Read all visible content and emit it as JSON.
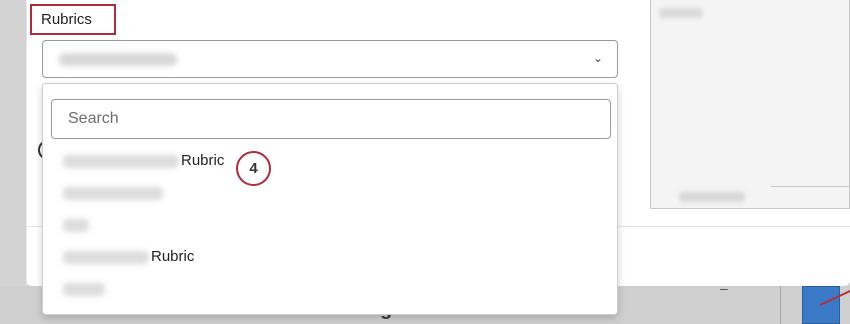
{
  "modal": {
    "section_label": "Rubrics",
    "select_chevron": "⌄",
    "select_chevron_icon": "chevron-down-icon"
  },
  "dropdown": {
    "search_placeholder": "Search",
    "options": [
      {
        "suffix": "Rubric"
      },
      {
        "suffix": ""
      },
      {
        "suffix": ""
      },
      {
        "suffix": "Rubric"
      },
      {
        "suffix": ""
      }
    ]
  },
  "annotation": {
    "step": "4"
  },
  "background": {
    "heading": "Rating for 0"
  },
  "colors": {
    "highlight_red": "#b22a3c",
    "accent_blue": "#3a79c6"
  }
}
